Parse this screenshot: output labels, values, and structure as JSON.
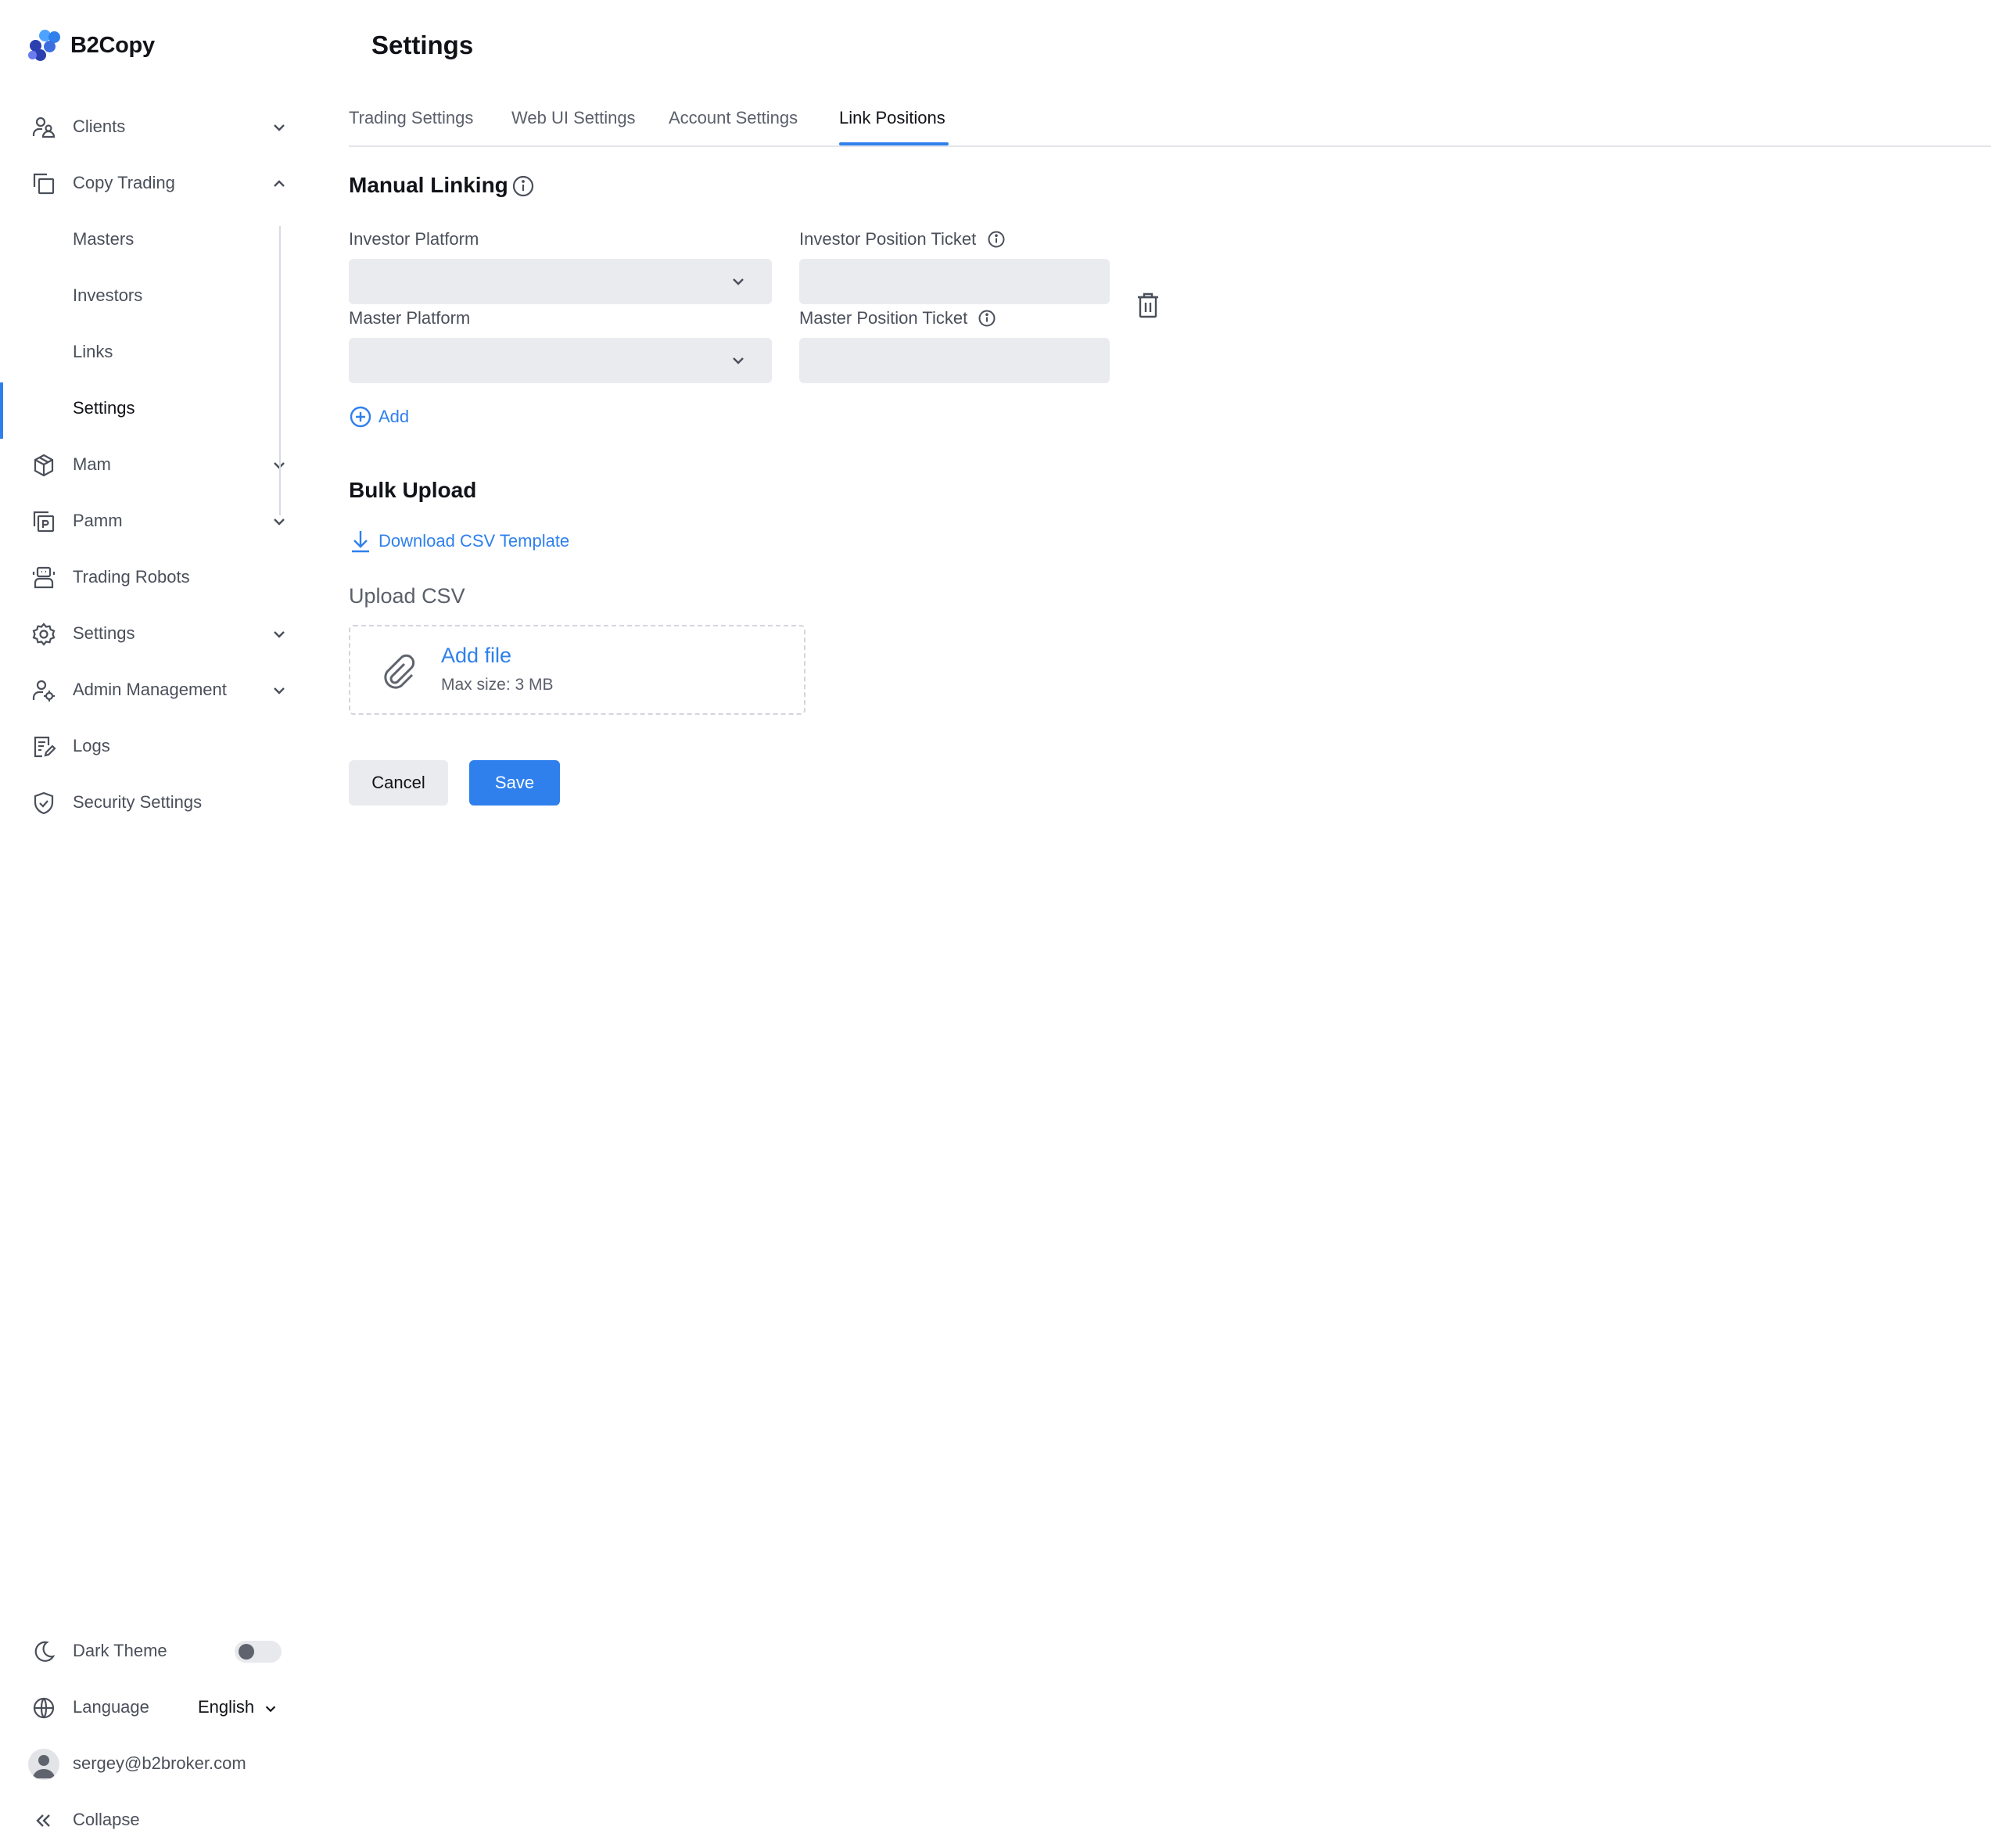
{
  "brand": {
    "name": "B2Copy",
    "colors": {
      "accent": "#2f80ed",
      "dark": "#2a3fb0",
      "light": "#4da3ff"
    }
  },
  "sidebar": {
    "items": [
      {
        "label": "Clients",
        "icon": "users-icon",
        "expandable": true,
        "expanded": false
      },
      {
        "label": "Copy Trading",
        "icon": "copy-icon",
        "expandable": true,
        "expanded": true,
        "children": [
          {
            "label": "Masters"
          },
          {
            "label": "Investors"
          },
          {
            "label": "Links"
          },
          {
            "label": "Settings",
            "active": true
          }
        ]
      },
      {
        "label": "Mam",
        "icon": "cube-icon",
        "expandable": true,
        "expanded": false
      },
      {
        "label": "Pamm",
        "icon": "pamm-icon",
        "expandable": true,
        "expanded": false
      },
      {
        "label": "Trading Robots",
        "icon": "robot-icon",
        "expandable": false
      },
      {
        "label": "Settings",
        "icon": "gear-icon",
        "expandable": true,
        "expanded": false
      },
      {
        "label": "Admin Management",
        "icon": "admin-icon",
        "expandable": true,
        "expanded": false
      },
      {
        "label": "Logs",
        "icon": "logs-icon",
        "expandable": false
      },
      {
        "label": "Security Settings",
        "icon": "shield-icon",
        "expandable": false
      }
    ],
    "bottom": {
      "dark_theme_label": "Dark Theme",
      "dark_theme_on": false,
      "language_label": "Language",
      "language_value": "English",
      "user_email": "sergey@b2broker.com",
      "collapse_label": "Collapse"
    }
  },
  "header": {
    "title": "Settings"
  },
  "tabs": [
    {
      "label": "Trading Settings",
      "active": false
    },
    {
      "label": "Web UI Settings",
      "active": false
    },
    {
      "label": "Account Settings",
      "active": false
    },
    {
      "label": "Link Positions",
      "active": true
    }
  ],
  "manual_linking": {
    "title": "Manual Linking",
    "investor_platform_label": "Investor Platform",
    "investor_platform_value": "",
    "investor_ticket_label": "Investor Position Ticket",
    "investor_ticket_value": "",
    "master_platform_label": "Master Platform",
    "master_platform_value": "",
    "master_ticket_label": "Master Position Ticket",
    "master_ticket_value": "",
    "add_label": "Add"
  },
  "bulk_upload": {
    "title": "Bulk Upload",
    "download_label": "Download CSV Template",
    "upload_label": "Upload CSV",
    "add_file_label": "Add file",
    "max_size_label": "Max size: 3 MB"
  },
  "actions": {
    "cancel_label": "Cancel",
    "save_label": "Save"
  }
}
